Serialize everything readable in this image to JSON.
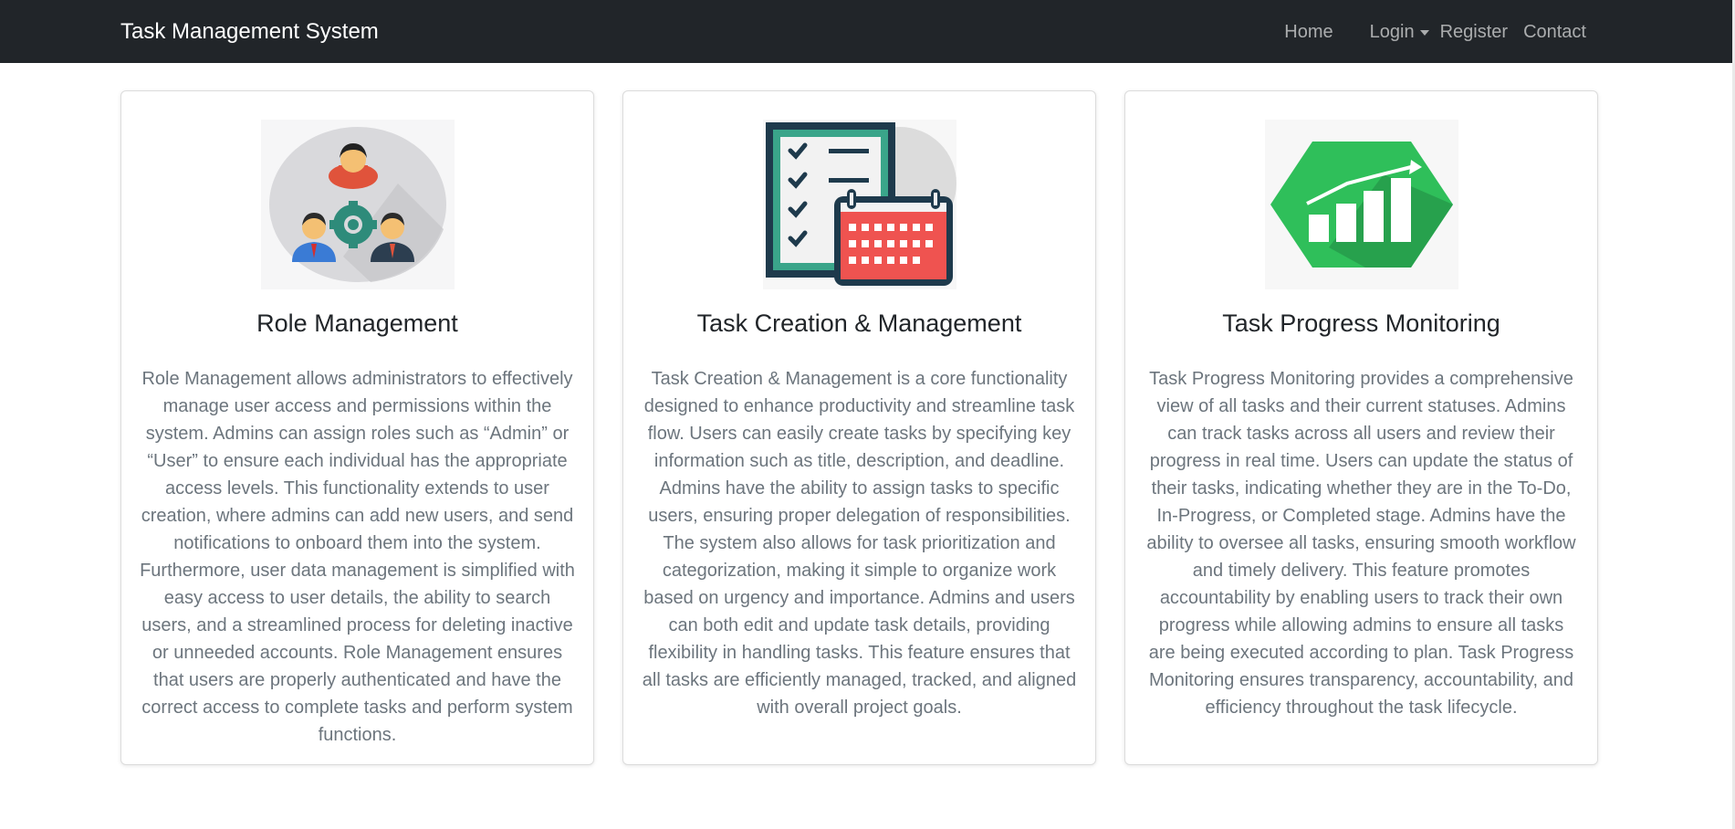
{
  "navbar": {
    "brand": "Task Management System",
    "links": {
      "home": "Home",
      "login": "Login",
      "register": "Register",
      "contact": "Contact"
    }
  },
  "cards": [
    {
      "image": "role-management-illustration",
      "title": "Role Management",
      "text": "Role Management allows administrators to effectively manage user access and permissions within the system. Admins can assign roles such as “Admin” or “User” to ensure each individual has the appropriate access levels. This functionality extends to user creation, where admins can add new users, and send notifications to onboard them into the system. Furthermore, user data management is simplified with easy access to user details, the ability to search users, and a streamlined process for deleting inactive or unneeded accounts. Role Management ensures that users are properly authenticated and have the correct access to complete tasks and perform system functions."
    },
    {
      "image": "task-checklist-calendar-illustration",
      "title": "Task Creation & Management",
      "text": "Task Creation & Management is a core functionality designed to enhance productivity and streamline task flow. Users can easily create tasks by specifying key information such as title, description, and deadline. Admins have the ability to assign tasks to specific users, ensuring proper delegation of responsibilities. The system also allows for task prioritization and categorization, making it simple to organize work based on urgency and importance. Admins and users can both edit and update task details, providing flexibility in handling tasks. This feature ensures that all tasks are efficiently managed, tracked, and aligned with overall project goals."
    },
    {
      "image": "progress-growth-chart-illustration",
      "title": "Task Progress Monitoring",
      "text": "Task Progress Monitoring provides a comprehensive view of all tasks and their current statuses. Admins can track tasks across all users and review their progress in real time. Users can update the status of their tasks, indicating whether they are in the To-Do, In-Progress, or Completed stage. Admins have the ability to oversee all tasks, ensuring smooth workflow and timely delivery. This feature promotes accountability by enabling users to track their own progress while allowing admins to ensure all tasks are being executed according to plan. Task Progress Monitoring ensures transparency, accountability, and efficiency throughout the task lifecycle."
    }
  ],
  "colors": {
    "navbar_bg": "#212529",
    "title": "#212529",
    "body_text": "#6c757d",
    "accent_teal": "#2e8b7a",
    "accent_red": "#ef5350",
    "accent_green": "#2fbf5a"
  }
}
